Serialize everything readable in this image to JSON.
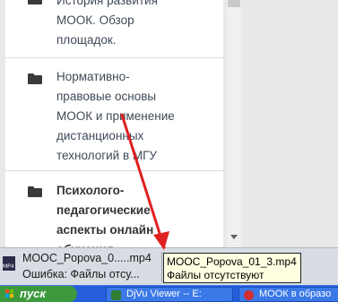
{
  "sidebar": {
    "items": [
      {
        "lines": [
          "История развития",
          "МООК. Обзор",
          "площадок."
        ]
      },
      {
        "lines": [
          "Нормативно-",
          "правовые основы",
          "МООК и применение",
          "дистанционных",
          "технологий в МГУ"
        ]
      },
      {
        "lines": [
          "Психолого-",
          "педагогические",
          "аспекты онлайн",
          "обучения"
        ]
      }
    ]
  },
  "downloads": {
    "item": {
      "icon_text": "MP4",
      "name": "MOOC_Popova_0.....mp4",
      "status": "Ошибка: Файлы отсу..."
    },
    "tooltip": {
      "name": "MOOC_Popova_01_3.mp4",
      "status": "Файлы отсутствуют"
    }
  },
  "taskbar": {
    "start_label": "пуск",
    "tasks": [
      {
        "label": "DjVu Viewer -- E:",
        "icon": "djvu-viewer-icon",
        "color": "#2e7d32"
      },
      {
        "label": "МООК в образо",
        "icon": "chrome-icon",
        "color": "#d32f2f"
      }
    ]
  },
  "annotation": {
    "color": "#e02020"
  }
}
